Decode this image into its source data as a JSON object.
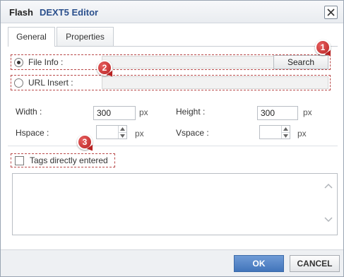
{
  "title": {
    "prefix": "Flash",
    "brand": "DEXT5 Editor"
  },
  "tabs": [
    {
      "label": "General",
      "active": true
    },
    {
      "label": "Properties",
      "active": false
    }
  ],
  "source": {
    "file_info_label": "File Info :",
    "file_info_selected": true,
    "file_info_value": "",
    "search_label": "Search",
    "url_insert_label": "URL Insert :",
    "url_insert_selected": false,
    "url_value": ""
  },
  "dimensions": {
    "width_label": "Width :",
    "width_value": "300",
    "height_label": "Height :",
    "height_value": "300",
    "hspace_label": "Hspace :",
    "hspace_value": "",
    "vspace_label": "Vspace :",
    "vspace_value": "",
    "unit": "px"
  },
  "tags": {
    "label": "Tags directly entered",
    "checked": false,
    "content": ""
  },
  "markers": [
    "1",
    "2",
    "3"
  ],
  "footer": {
    "ok_label": "OK",
    "cancel_label": "CANCEL"
  },
  "colors": {
    "brand": "#2a4f8c",
    "ok_button": "#4275bb",
    "marker": "#b82222",
    "highlight_border": "#b94a4a"
  },
  "icons": {
    "close": "close-icon",
    "spin_up": "chevron-up-icon",
    "spin_down": "chevron-down-icon",
    "scroll_up": "chevron-up-icon",
    "scroll_down": "chevron-down-icon"
  }
}
